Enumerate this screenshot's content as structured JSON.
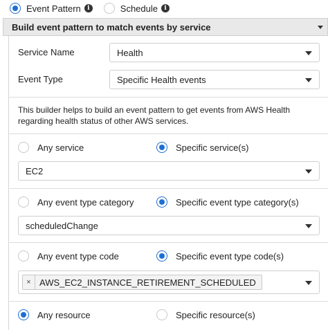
{
  "mode": {
    "event_pattern_label": "Event Pattern",
    "schedule_label": "Schedule",
    "info_glyph": "i"
  },
  "builder": {
    "title": "Build event pattern to match events by service"
  },
  "service_name": {
    "label": "Service Name",
    "value": "Health"
  },
  "event_type": {
    "label": "Event Type",
    "value": "Specific Health events"
  },
  "description": "This builder helps to build an event pattern to get events from AWS Health regarding health status of other AWS services.",
  "service_scope": {
    "any_label": "Any service",
    "specific_label": "Specific service(s)",
    "selected": "specific",
    "value": "EC2"
  },
  "category_scope": {
    "any_label": "Any event type category",
    "specific_label": "Specific event type category(s)",
    "selected": "specific",
    "value": "scheduledChange"
  },
  "code_scope": {
    "any_label": "Any event type code",
    "specific_label": "Specific event type code(s)",
    "selected": "specific",
    "chip_remove": "×",
    "chip_value": "AWS_EC2_INSTANCE_RETIREMENT_SCHEDULED"
  },
  "resource_scope": {
    "any_label": "Any resource",
    "specific_label": "Specific resource(s)",
    "selected": "any"
  },
  "colors": {
    "accent": "#1f6fd1",
    "bar": "#e9e9e9",
    "border": "#cfcfcf"
  }
}
